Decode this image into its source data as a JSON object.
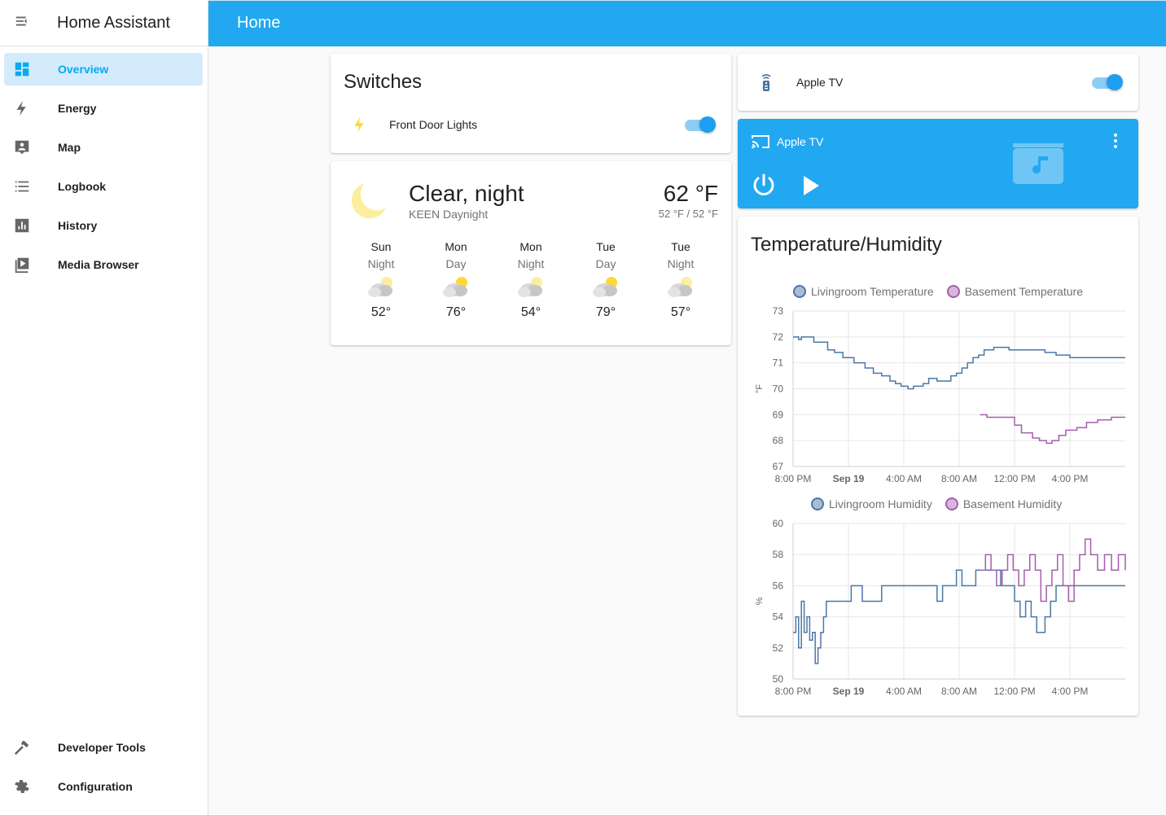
{
  "app": {
    "title": "Home Assistant"
  },
  "sidebar": {
    "items": [
      {
        "label": "Overview",
        "icon": "dashboard-icon",
        "active": true
      },
      {
        "label": "Energy",
        "icon": "lightning-icon"
      },
      {
        "label": "Map",
        "icon": "map-account-icon"
      },
      {
        "label": "Logbook",
        "icon": "logbook-list-icon"
      },
      {
        "label": "History",
        "icon": "history-chart-icon"
      },
      {
        "label": "Media Browser",
        "icon": "media-play-icon"
      }
    ],
    "bottom_items": [
      {
        "label": "Developer Tools",
        "icon": "hammer-icon"
      },
      {
        "label": "Configuration",
        "icon": "gear-icon"
      }
    ]
  },
  "header": {
    "title": "Home"
  },
  "switches": {
    "title": "Switches",
    "entity": {
      "name": "Front Door Lights",
      "icon": "lightning-icon",
      "state": "on"
    }
  },
  "weather": {
    "condition": "Clear, night",
    "station": "KEEN Daynight",
    "temperature": "62 °F",
    "hilo": "52 °F / 52 °F",
    "forecast": [
      {
        "day": "Sun",
        "time": "Night",
        "temp": "52°",
        "icon": "partly-cloudy-night-icon"
      },
      {
        "day": "Mon",
        "time": "Day",
        "temp": "76°",
        "icon": "partly-cloudy-day-icon"
      },
      {
        "day": "Mon",
        "time": "Night",
        "temp": "54°",
        "icon": "partly-cloudy-night-icon"
      },
      {
        "day": "Tue",
        "time": "Day",
        "temp": "79°",
        "icon": "partly-cloudy-day-icon"
      },
      {
        "day": "Tue",
        "time": "Night",
        "temp": "57°",
        "icon": "partly-cloudy-night-icon"
      }
    ]
  },
  "apple_tv_entity": {
    "name": "Apple TV",
    "icon": "remote-icon",
    "state": "on"
  },
  "media_player": {
    "name": "Apple TV",
    "accent": "#21a8f1"
  },
  "history_card": {
    "title": "Temperature/Humidity"
  },
  "chart_data": [
    {
      "type": "line",
      "ylabel": "°F",
      "ylim": [
        67,
        73
      ],
      "yticks": [
        "73",
        "72",
        "71",
        "70",
        "69",
        "68",
        "67"
      ],
      "xticks": [
        "8:00 PM",
        "Sep 19",
        "4:00 AM",
        "8:00 AM",
        "12:00 PM",
        "4:00 PM"
      ],
      "x_hours": [
        0,
        4,
        8,
        12,
        16,
        20
      ],
      "legend_placement": "top",
      "step": true,
      "series": [
        {
          "name": "Livingroom Temperature",
          "color": "#4c77a5",
          "x": [
            0,
            0.4,
            0.6,
            0.8,
            1.5,
            2.5,
            3.0,
            3.6,
            4.4,
            5.2,
            5.8,
            6.4,
            7.0,
            7.4,
            7.8,
            8.3,
            8.7,
            9.4,
            9.8,
            10.4,
            10.9,
            11.4,
            11.8,
            12.2,
            12.6,
            13.0,
            13.4,
            13.8,
            14.5,
            15.1,
            15.6,
            16.4,
            18.2,
            19.0,
            20.0,
            24.0
          ],
          "y": [
            72.0,
            71.9,
            72.0,
            72.0,
            71.8,
            71.5,
            71.4,
            71.2,
            71.0,
            70.8,
            70.6,
            70.5,
            70.3,
            70.2,
            70.1,
            70.0,
            70.1,
            70.2,
            70.4,
            70.3,
            70.3,
            70.5,
            70.6,
            70.8,
            71.0,
            71.2,
            71.3,
            71.5,
            71.6,
            71.6,
            71.5,
            71.5,
            71.4,
            71.3,
            71.2,
            71.2
          ]
        },
        {
          "name": "Basement Temperature",
          "color": "#a45fac",
          "x": [
            13.5,
            14.0,
            14.5,
            15.5,
            16.0,
            16.5,
            17.3,
            17.8,
            18.3,
            18.7,
            19.2,
            19.7,
            20.5,
            21.2,
            22.0,
            23.0,
            24.0
          ],
          "y": [
            69.0,
            68.9,
            68.9,
            68.9,
            68.6,
            68.3,
            68.1,
            68.0,
            67.9,
            68.0,
            68.2,
            68.4,
            68.5,
            68.7,
            68.8,
            68.9,
            68.9
          ]
        }
      ]
    },
    {
      "type": "line",
      "ylabel": "%",
      "ylim": [
        50,
        60
      ],
      "yticks": [
        "60",
        "58",
        "56",
        "54",
        "52",
        "50"
      ],
      "xticks": [
        "8:00 PM",
        "Sep 19",
        "4:00 AM",
        "8:00 AM",
        "12:00 PM",
        "4:00 PM"
      ],
      "x_hours": [
        0,
        4,
        8,
        12,
        16,
        20
      ],
      "legend_placement": "top",
      "step": true,
      "series": [
        {
          "name": "Livingroom Humidity",
          "color": "#4c77a5",
          "x": [
            0,
            0.2,
            0.4,
            0.6,
            0.8,
            1.0,
            1.2,
            1.4,
            1.6,
            1.8,
            2.0,
            2.2,
            2.4,
            2.6,
            3.2,
            4.2,
            5.0,
            6.4,
            10.4,
            10.8,
            11.2,
            11.8,
            12.2,
            13.2,
            15.0,
            16.0,
            16.4,
            16.8,
            17.2,
            17.6,
            18.2,
            18.6,
            19.0,
            19.6,
            24.0
          ],
          "y": [
            53.0,
            54.0,
            52.0,
            55.0,
            53.0,
            54.0,
            52.5,
            53.0,
            51.0,
            52.0,
            53.0,
            54.0,
            55.0,
            55.0,
            55.0,
            56.0,
            55.0,
            56.0,
            55.0,
            56.0,
            56.0,
            57.0,
            56.0,
            57.0,
            56.0,
            55.0,
            54.0,
            55.0,
            54.0,
            53.0,
            54.0,
            55.0,
            56.0,
            56.0,
            56.0
          ]
        },
        {
          "name": "Basement Humidity",
          "color": "#a45fac",
          "x": [
            13.5,
            13.9,
            14.3,
            14.7,
            15.1,
            15.5,
            15.9,
            16.3,
            16.7,
            17.1,
            17.5,
            17.9,
            18.3,
            18.7,
            19.1,
            19.5,
            19.9,
            20.3,
            20.7,
            21.1,
            21.5,
            22.0,
            22.5,
            23.0,
            23.5,
            24.0
          ],
          "y": [
            57.0,
            58.0,
            57.0,
            56.0,
            57.0,
            58.0,
            57.0,
            56.0,
            57.0,
            58.0,
            57.0,
            55.0,
            56.0,
            57.0,
            58.0,
            56.0,
            55.0,
            57.0,
            58.0,
            59.0,
            58.0,
            57.0,
            58.0,
            57.0,
            58.0,
            57.0
          ]
        }
      ]
    }
  ]
}
